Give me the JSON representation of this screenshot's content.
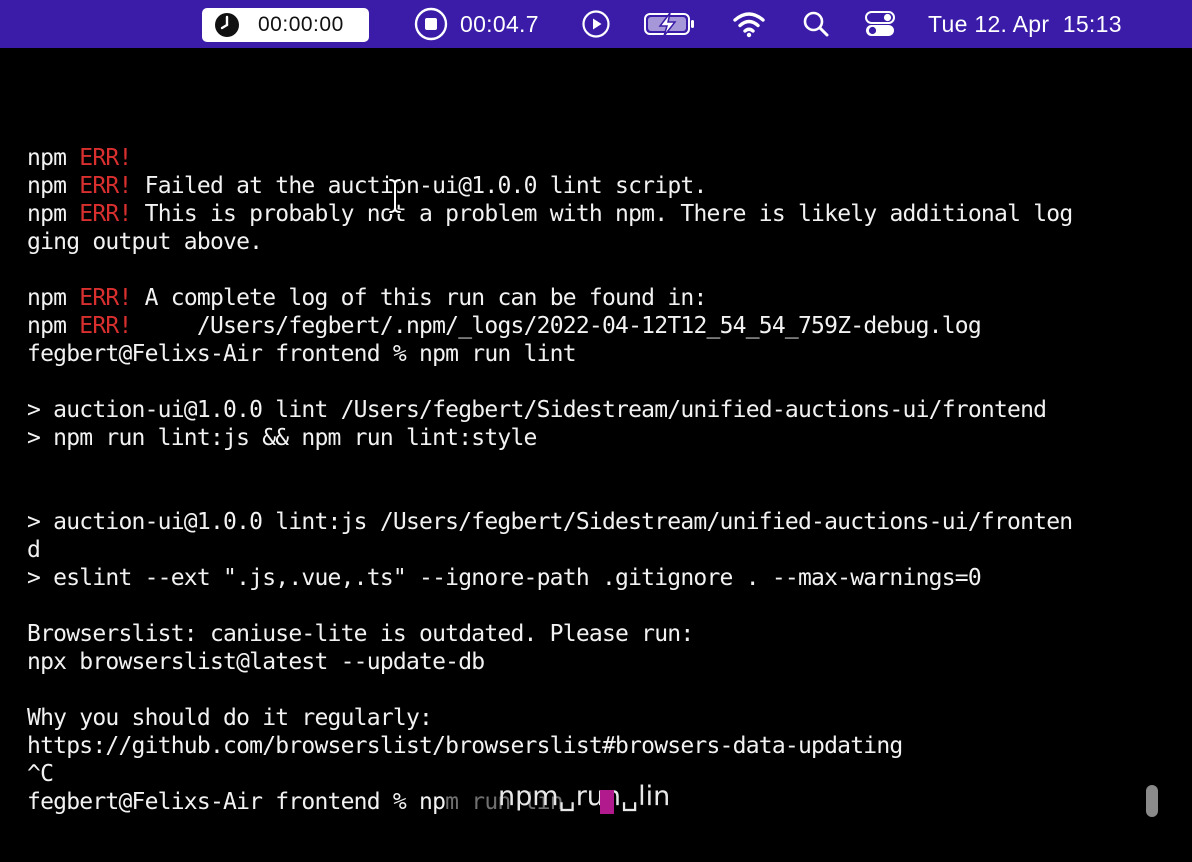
{
  "menubar": {
    "timer": "00:00:00",
    "recording_time": "00:04.7",
    "date_time": "Tue 12. Apr  15:13",
    "icons": [
      "clock-icon",
      "stop-record-icon",
      "play-icon",
      "battery-charging-icon",
      "wifi-icon",
      "search-icon",
      "control-center-icon"
    ]
  },
  "terminal": {
    "lines": [
      {
        "prefix": "npm ",
        "err": "ERR!",
        "text": ""
      },
      {
        "prefix": "npm ",
        "err": "ERR!",
        "text": " Failed at the auction-ui@1.0.0 lint script."
      },
      {
        "prefix": "npm ",
        "err": "ERR!",
        "text": " This is probably not a problem with npm. There is likely additional log"
      },
      {
        "prefix": "",
        "err": "",
        "text": "ging output above."
      },
      {
        "prefix": "",
        "err": "",
        "text": ""
      },
      {
        "prefix": "npm ",
        "err": "ERR!",
        "text": " A complete log of this run can be found in:"
      },
      {
        "prefix": "npm ",
        "err": "ERR!",
        "text": "     /Users/fegbert/.npm/_logs/2022-04-12T12_54_54_759Z-debug.log"
      },
      {
        "prefix": "",
        "err": "",
        "text": "fegbert@Felixs-Air frontend % npm run lint"
      },
      {
        "prefix": "",
        "err": "",
        "text": ""
      },
      {
        "prefix": "",
        "err": "",
        "text": "> auction-ui@1.0.0 lint /Users/fegbert/Sidestream/unified-auctions-ui/frontend"
      },
      {
        "prefix": "",
        "err": "",
        "text": "> npm run lint:js && npm run lint:style"
      },
      {
        "prefix": "",
        "err": "",
        "text": ""
      },
      {
        "prefix": "",
        "err": "",
        "text": ""
      },
      {
        "prefix": "",
        "err": "",
        "text": "> auction-ui@1.0.0 lint:js /Users/fegbert/Sidestream/unified-auctions-ui/fronten"
      },
      {
        "prefix": "",
        "err": "",
        "text": "d"
      },
      {
        "prefix": "",
        "err": "",
        "text": "> eslint --ext \".js,.vue,.ts\" --ignore-path .gitignore . --max-warnings=0"
      },
      {
        "prefix": "",
        "err": "",
        "text": ""
      },
      {
        "prefix": "",
        "err": "",
        "text": "Browserslist: caniuse-lite is outdated. Please run:"
      },
      {
        "prefix": "",
        "err": "",
        "text": "npx browserslist@latest --update-db"
      },
      {
        "prefix": "",
        "err": "",
        "text": ""
      },
      {
        "prefix": "",
        "err": "",
        "text": "Why you should do it regularly:"
      },
      {
        "prefix": "",
        "err": "",
        "text": "https://github.com/browserslist/browserslist#browsers-data-updating"
      },
      {
        "prefix": "",
        "err": "",
        "text": "^C"
      }
    ],
    "prompt": "fegbert@Felixs-Air frontend % np",
    "prompt_ghost": "m run lin",
    "ime_composition": "npm␣run␣lin"
  }
}
